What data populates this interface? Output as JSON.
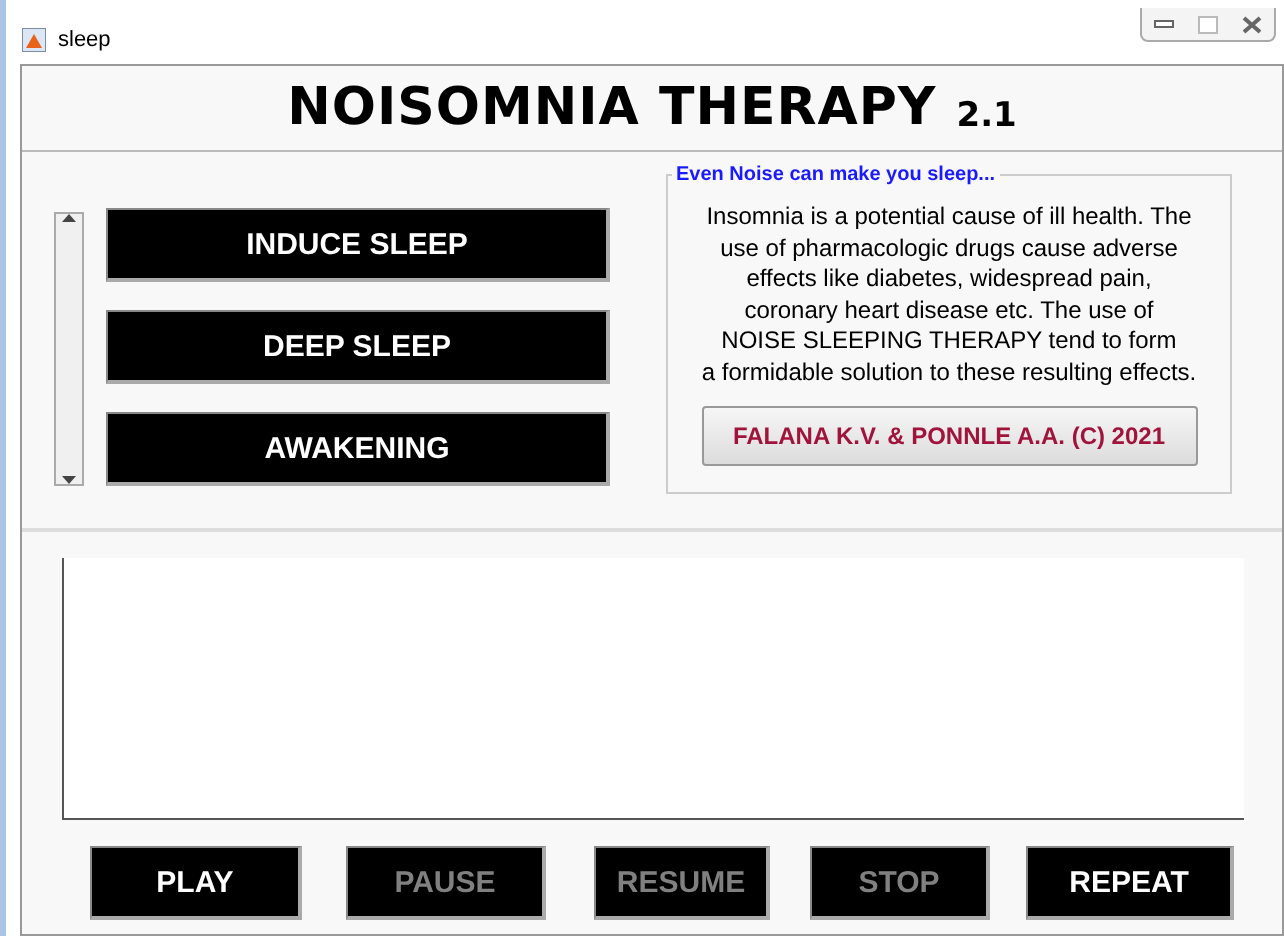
{
  "window": {
    "title": "sleep"
  },
  "header": {
    "title": "NOISOMNIA THERAPY",
    "version": "2.1"
  },
  "modes": [
    {
      "label": "INDUCE SLEEP",
      "disabled": false
    },
    {
      "label": "DEEP SLEEP",
      "disabled": false
    },
    {
      "label": "AWAKENING",
      "disabled": false
    }
  ],
  "info": {
    "legend": "Even Noise can make you sleep...",
    "lines": [
      "Insomnia is a potential cause of ill health. The",
      "use of pharmacologic drugs cause adverse",
      "effects like diabetes, widespread pain,",
      "coronary heart disease etc. The use of",
      "NOISE SLEEPING THERAPY tend to form",
      "a formidable solution to these resulting effects."
    ],
    "credit": "FALANA K.V. & PONNLE A.A. (C) 2021"
  },
  "controls": [
    {
      "label": "PLAY",
      "disabled": false
    },
    {
      "label": "PAUSE",
      "disabled": true
    },
    {
      "label": "RESUME",
      "disabled": true
    },
    {
      "label": "STOP",
      "disabled": true
    },
    {
      "label": "REPEAT",
      "disabled": false
    }
  ]
}
